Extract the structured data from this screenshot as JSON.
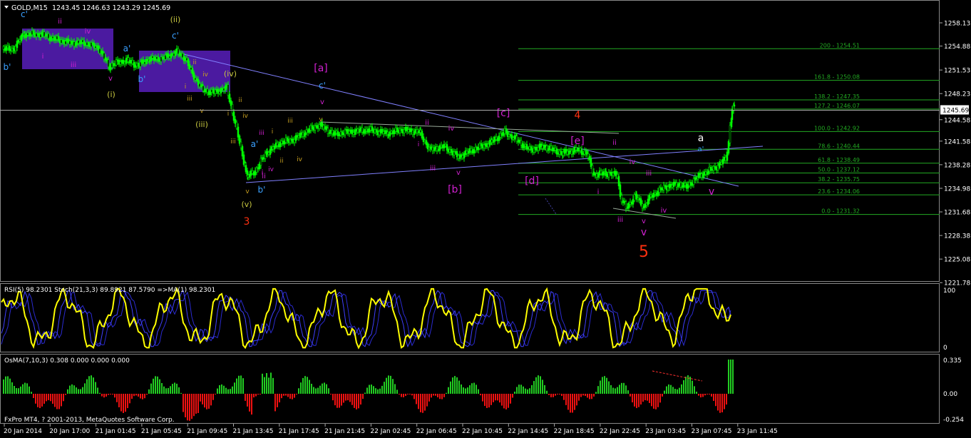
{
  "header": {
    "symbol": "GOLD,M15",
    "ohlc": "1243.45 1246.63 1243.29 1245.69"
  },
  "price_axis": {
    "ticks": [
      "1258.13",
      "1254.88",
      "1251.53",
      "1248.23",
      "1244.58",
      "1241.58",
      "1238.28",
      "1234.98",
      "1231.68",
      "1228.38",
      "1225.08",
      "1221.78"
    ],
    "current_price": "1245.69",
    "current_price_value": 1245.69
  },
  "rsi_panel": {
    "label": "RSI(5) 98.2301  Stoch(21,3,3) 89.8921 87.5790  =>MA(1) 98.2301",
    "ticks": [
      "100",
      "0"
    ]
  },
  "osma_panel": {
    "label": "OsMA(7,10,3) 0.308 0.000 0.000 0.000",
    "ticks": [
      "0.335",
      "0.00",
      "-0.254"
    ]
  },
  "footer": "FxPro MT4, ? 2001-2013, MetaQuotes Software Corp.",
  "time_axis": [
    "20 Jan 2014",
    "20 Jan 17:00",
    "21 Jan 01:45",
    "21 Jan 05:45",
    "21 Jan 09:45",
    "21 Jan 13:45",
    "21 Jan 17:45",
    "21 Jan 21:45",
    "22 Jan 02:45",
    "22 Jan 06:45",
    "22 Jan 10:45",
    "22 Jan 14:45",
    "22 Jan 18:45",
    "22 Jan 22:45",
    "23 Jan 03:45",
    "23 Jan 07:45",
    "23 Jan 11:45"
  ],
  "fib_levels": [
    {
      "label": "200 - 1254.51",
      "price": 1254.51
    },
    {
      "label": "161.8 - 1250.08",
      "price": 1250.08
    },
    {
      "label": "138.2 - 1247.35",
      "price": 1247.35
    },
    {
      "label": "127.2 - 1246.07",
      "price": 1246.07
    },
    {
      "label": "100.0 - 1242.92",
      "price": 1242.92
    },
    {
      "label": "78.6 - 1240.44",
      "price": 1240.44
    },
    {
      "label": "61.8 - 1238.49",
      "price": 1238.49
    },
    {
      "label": "50.0 - 1237.12",
      "price": 1237.12
    },
    {
      "label": "38.2 - 1235.75",
      "price": 1235.75
    },
    {
      "label": "23.6 - 1234.06",
      "price": 1234.06
    },
    {
      "label": "0.0 - 1231.32",
      "price": 1231.32
    }
  ],
  "wave_labels": [
    {
      "text": "c'",
      "color": "#3aa0ff"
    },
    {
      "text": "b'",
      "color": "#3aa0ff"
    },
    {
      "text": "i",
      "color": "#d020d0"
    },
    {
      "text": "ii",
      "color": "#d020d0"
    },
    {
      "text": "iii",
      "color": "#d020d0"
    },
    {
      "text": "iv",
      "color": "#d020d0"
    },
    {
      "text": "v",
      "color": "#d020d0"
    },
    {
      "text": "(i)",
      "color": "#c8c840"
    },
    {
      "text": "a'",
      "color": "#3aa0ff"
    },
    {
      "text": "(ii)",
      "color": "#c8c840"
    },
    {
      "text": "c'",
      "color": "#3aa0ff"
    },
    {
      "text": "b'",
      "color": "#3aa0ff"
    },
    {
      "text": "i",
      "color": "#c8a020"
    },
    {
      "text": "ii",
      "color": "#c8a020"
    },
    {
      "text": "iii",
      "color": "#c8a020"
    },
    {
      "text": "iv",
      "color": "#c8a020"
    },
    {
      "text": "v",
      "color": "#c8a020"
    },
    {
      "text": "(iii)",
      "color": "#c8c840"
    },
    {
      "text": "(iv)",
      "color": "#c8c840"
    },
    {
      "text": "i",
      "color": "#c8a020"
    },
    {
      "text": "ii",
      "color": "#c8a020"
    },
    {
      "text": "iii",
      "color": "#c8a020"
    },
    {
      "text": "iv",
      "color": "#c8a020"
    },
    {
      "text": "v",
      "color": "#c8a020"
    },
    {
      "text": "(v)",
      "color": "#c8c840"
    },
    {
      "text": "3",
      "color": "#ff3010"
    },
    {
      "text": "a'",
      "color": "#3aa0ff"
    },
    {
      "text": "b'",
      "color": "#3aa0ff"
    },
    {
      "text": "i",
      "color": "#d020d0"
    },
    {
      "text": "ii",
      "color": "#d020d0"
    },
    {
      "text": "iii",
      "color": "#d020d0"
    },
    {
      "text": "iv",
      "color": "#d020d0"
    },
    {
      "text": "i",
      "color": "#c8a020"
    },
    {
      "text": "ii",
      "color": "#c8a020"
    },
    {
      "text": "iii",
      "color": "#c8a020"
    },
    {
      "text": "iv",
      "color": "#c8a020"
    },
    {
      "text": "[a]",
      "color": "#d020d0"
    },
    {
      "text": "c'",
      "color": "#3aa0ff"
    },
    {
      "text": "v",
      "color": "#d020d0"
    },
    {
      "text": "v",
      "color": "#c8a020"
    },
    {
      "text": "i",
      "color": "#d020d0"
    },
    {
      "text": "ii",
      "color": "#d020d0"
    },
    {
      "text": "iii",
      "color": "#d020d0"
    },
    {
      "text": "iv",
      "color": "#d020d0"
    },
    {
      "text": "v",
      "color": "#d020d0"
    },
    {
      "text": "[b]",
      "color": "#d020d0"
    },
    {
      "text": "[c]",
      "color": "#d020d0"
    },
    {
      "text": "4",
      "color": "#ff3010"
    },
    {
      "text": "[d]",
      "color": "#d020d0"
    },
    {
      "text": "[e]",
      "color": "#d020d0"
    },
    {
      "text": "i",
      "color": "#d020d0"
    },
    {
      "text": "ii",
      "color": "#d020d0"
    },
    {
      "text": "iii",
      "color": "#d020d0"
    },
    {
      "text": "iv",
      "color": "#d020d0"
    },
    {
      "text": "v",
      "color": "#d020d0"
    },
    {
      "text": "iii",
      "color": "#d020d0"
    },
    {
      "text": "iv",
      "color": "#d020d0"
    },
    {
      "text": "v",
      "color": "#d020d0"
    },
    {
      "text": "5",
      "color": "#ff3010"
    },
    {
      "text": "a",
      "color": "#ffffff"
    },
    {
      "text": "a'",
      "color": "#3aa0ff"
    },
    {
      "text": "v",
      "color": "#d020d0"
    },
    {
      "text": "b'",
      "color": "#3aa0ff"
    }
  ],
  "chart_data": {
    "type": "line",
    "instrument": "GOLD",
    "timeframe": "M15",
    "x": [
      "20 Jan 2014",
      "20 Jan 17:00",
      "21 Jan 01:45",
      "21 Jan 05:45",
      "21 Jan 09:45",
      "21 Jan 13:45",
      "21 Jan 17:45",
      "21 Jan 21:45",
      "22 Jan 02:45",
      "22 Jan 06:45",
      "22 Jan 10:45",
      "22 Jan 14:45",
      "22 Jan 18:45",
      "22 Jan 22:45",
      "23 Jan 03:45",
      "23 Jan 07:45"
    ],
    "series": [
      {
        "values": [
          1253.8,
          1256.5,
          1252.5,
          1254.0,
          1247.0,
          1236.5,
          1242.0,
          1243.5,
          1242.8,
          1240.5,
          1242.0,
          1241.5,
          1240.0,
          1232.0,
          1234.5,
          1245.7
        ]
      }
    ],
    "ylim": [
      1221.78,
      1259.5
    ],
    "ohlc_last": {
      "open": 1243.45,
      "high": 1246.63,
      "low": 1243.29,
      "close": 1245.69
    },
    "rsi_last": 98.2301,
    "osma_last": 0.308,
    "grid": false
  },
  "colors": {
    "background": "#000000",
    "candles": "#00ff00",
    "fib": "#22aa22",
    "trendline": "#8080ff",
    "rsi": "#ffff00",
    "stoch": "#4040ff",
    "osma_pos": "#22cc22",
    "osma_neg": "#ee1111",
    "box": "#4b1aa0",
    "axis_text": "#ffffff"
  }
}
